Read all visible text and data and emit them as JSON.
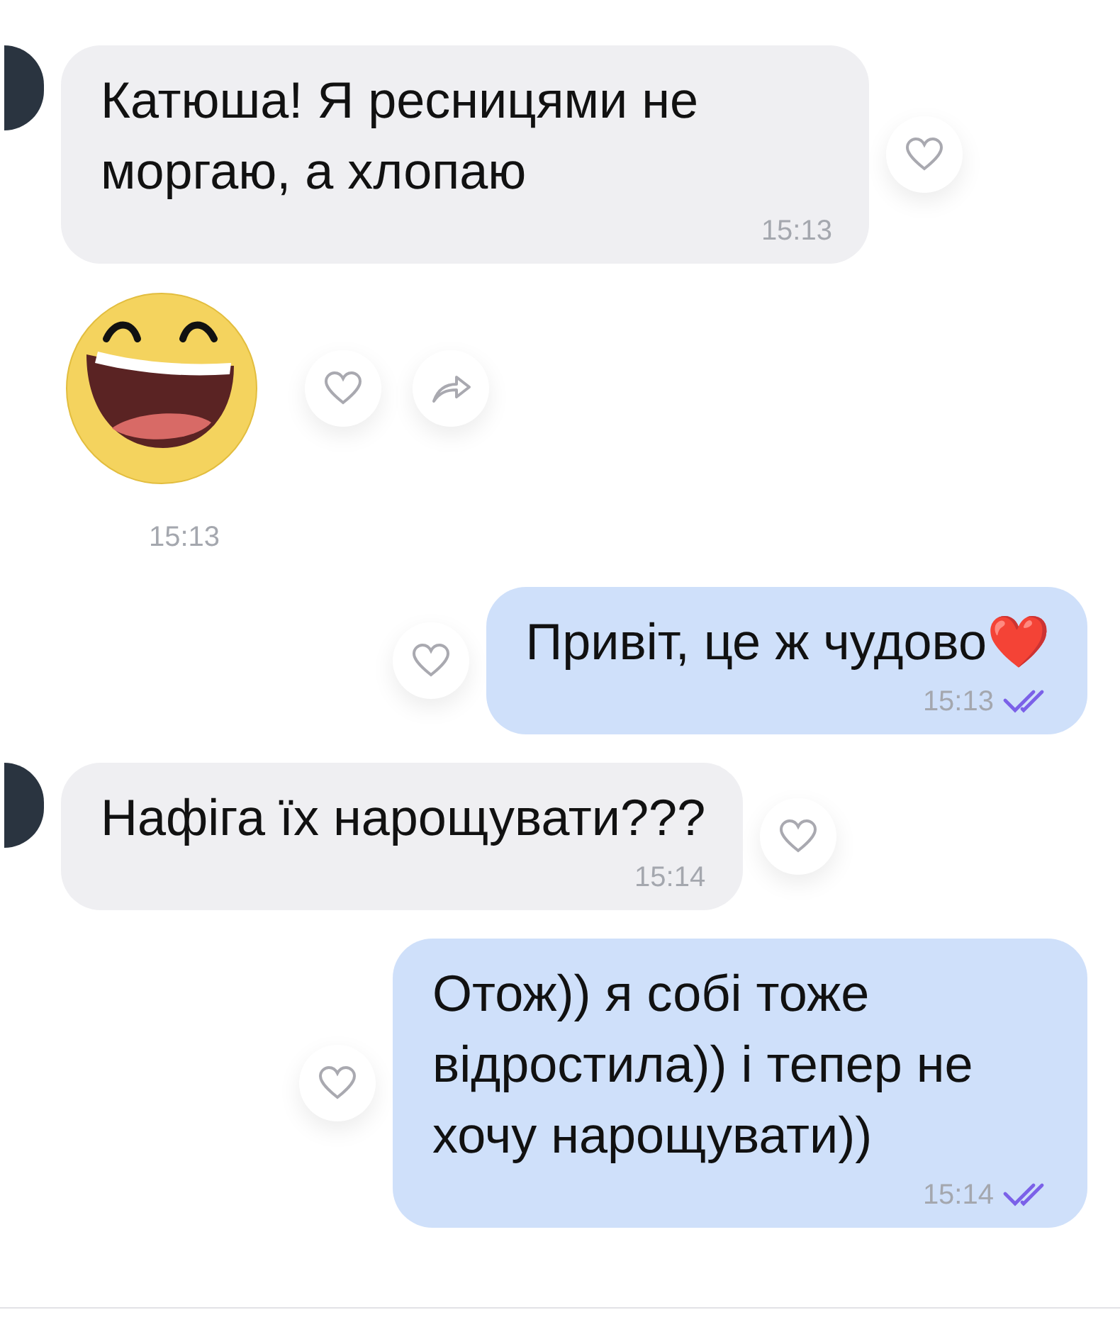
{
  "messages": [
    {
      "kind": "text",
      "outgoing": false,
      "avatar": true,
      "text": "Катюша! Я ресницями не моргаю, а хлопаю",
      "time": "15:13"
    },
    {
      "kind": "sticker",
      "outgoing": false,
      "avatar": false,
      "time": "15:13"
    },
    {
      "kind": "text",
      "outgoing": true,
      "text": "Привіт, це ж чудово❤️",
      "time": "15:13",
      "read": true
    },
    {
      "kind": "text",
      "outgoing": false,
      "avatar": true,
      "text": "Нафіга їх нарощувати???",
      "time": "15:14"
    },
    {
      "kind": "text",
      "outgoing": true,
      "text": "Отож)) я собі тоже відростила)) і тепер не хочу нарощувати))",
      "time": "15:14",
      "read": true
    }
  ]
}
